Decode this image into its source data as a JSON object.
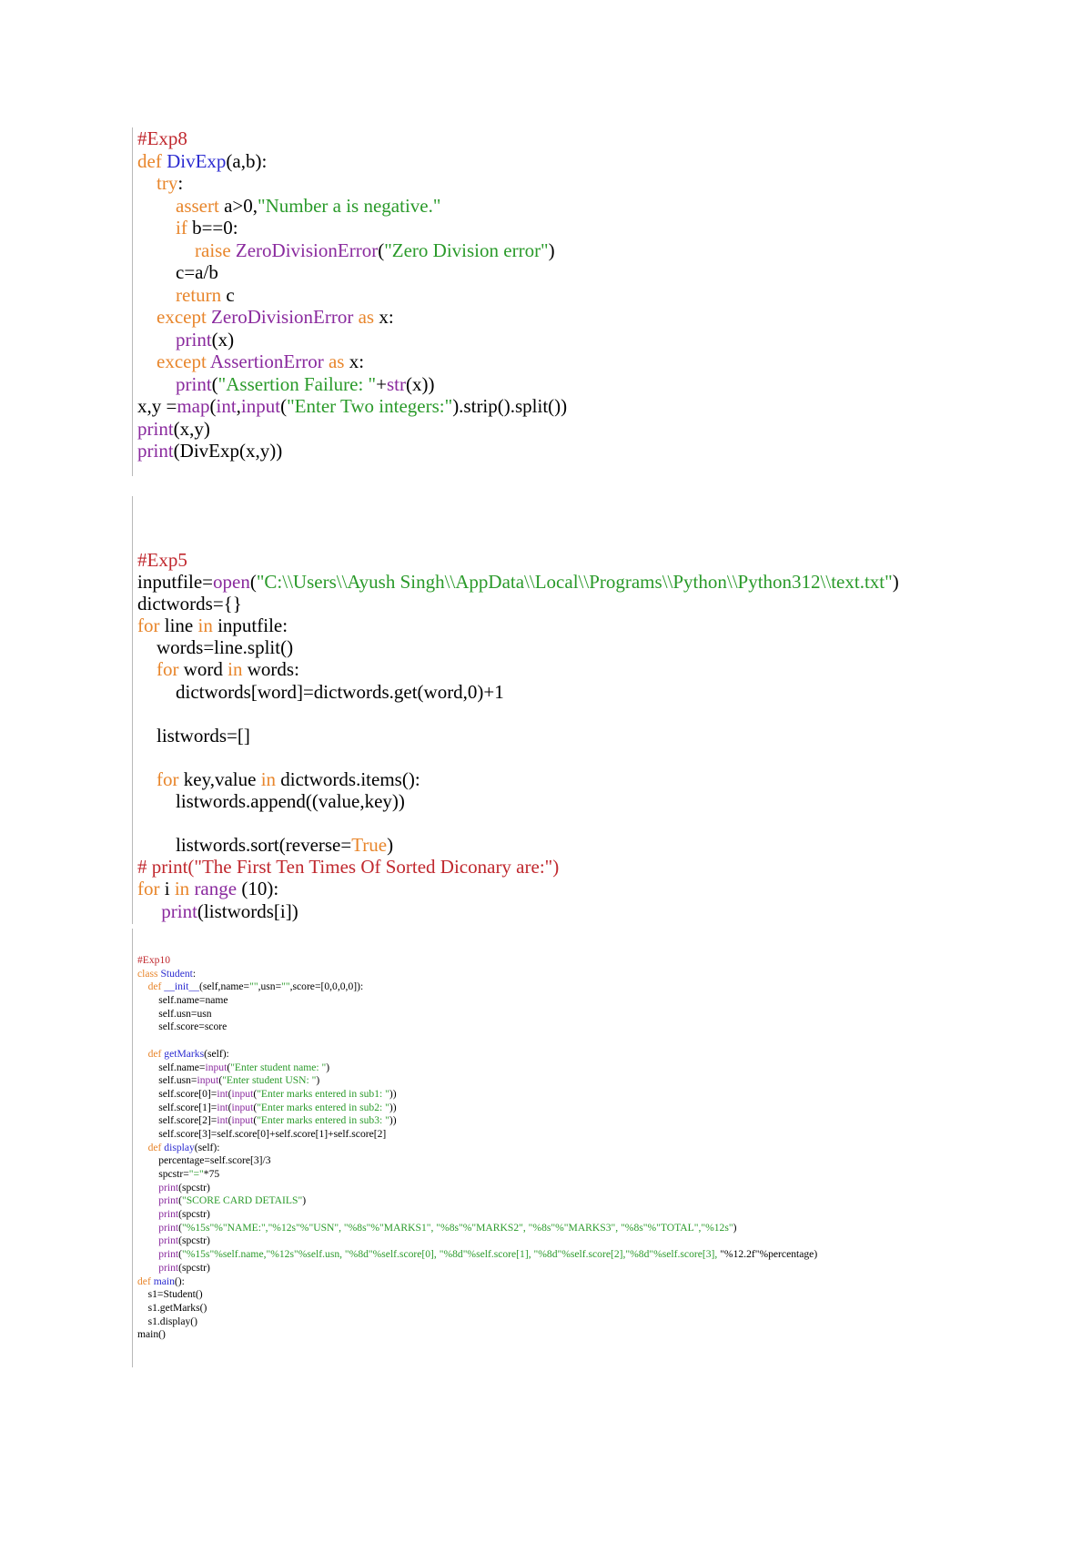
{
  "colors": {
    "comment": "#c0282e",
    "keyword": "#e8862c",
    "function_name": "#2b2bd0",
    "string": "#2a9a2a",
    "builtin": "#8a2a9e",
    "text": "#000000"
  },
  "exp8": [
    [
      [
        "cm",
        "#Exp8"
      ]
    ],
    [
      [
        "kw",
        "def "
      ],
      [
        "fn",
        "DivExp"
      ],
      [
        "tx",
        "(a,b):"
      ]
    ],
    [
      [
        "tx",
        "    "
      ],
      [
        "kw",
        "try"
      ],
      [
        "tx",
        ":"
      ]
    ],
    [
      [
        "tx",
        "        "
      ],
      [
        "kw",
        "assert "
      ],
      [
        "tx",
        "a>0,"
      ],
      [
        "st",
        "\"Number a is negative.\""
      ]
    ],
    [
      [
        "tx",
        "        "
      ],
      [
        "kw",
        "if "
      ],
      [
        "tx",
        "b==0:"
      ]
    ],
    [
      [
        "tx",
        "            "
      ],
      [
        "kw",
        "raise "
      ],
      [
        "bi",
        "ZeroDivisionError"
      ],
      [
        "tx",
        "("
      ],
      [
        "st",
        "\"Zero Division error\""
      ],
      [
        "tx",
        ")"
      ]
    ],
    [
      [
        "tx",
        "        c=a/b"
      ]
    ],
    [
      [
        "tx",
        "        "
      ],
      [
        "kw",
        "return "
      ],
      [
        "tx",
        "c"
      ]
    ],
    [
      [
        "tx",
        "    "
      ],
      [
        "kw",
        "except "
      ],
      [
        "bi",
        "ZeroDivisionError"
      ],
      [
        "kw",
        " as "
      ],
      [
        "tx",
        "x:"
      ]
    ],
    [
      [
        "tx",
        "        "
      ],
      [
        "bi",
        "print"
      ],
      [
        "tx",
        "(x)"
      ]
    ],
    [
      [
        "tx",
        "    "
      ],
      [
        "kw",
        "except "
      ],
      [
        "bi",
        "AssertionError"
      ],
      [
        "kw",
        " as "
      ],
      [
        "tx",
        "x:"
      ]
    ],
    [
      [
        "tx",
        "        "
      ],
      [
        "bi",
        "print"
      ],
      [
        "tx",
        "("
      ],
      [
        "st",
        "\"Assertion Failure: \""
      ],
      [
        "tx",
        "+"
      ],
      [
        "bi",
        "str"
      ],
      [
        "tx",
        "(x))"
      ]
    ],
    [
      [
        "tx",
        "x,y ="
      ],
      [
        "bi",
        "map"
      ],
      [
        "tx",
        "("
      ],
      [
        "bi",
        "int"
      ],
      [
        "tx",
        ","
      ],
      [
        "bi",
        "input"
      ],
      [
        "tx",
        "("
      ],
      [
        "st",
        "\"Enter Two integers:\""
      ],
      [
        "tx",
        ").strip().split())"
      ]
    ],
    [
      [
        "bi",
        "print"
      ],
      [
        "tx",
        "(x,y)"
      ]
    ],
    [
      [
        "bi",
        "print"
      ],
      [
        "tx",
        "(DivExp(x,y))"
      ]
    ]
  ],
  "exp5": [
    [
      [
        "cm",
        "#Exp5"
      ]
    ],
    [
      [
        "tx",
        "inputfile="
      ],
      [
        "bi",
        "open"
      ],
      [
        "tx",
        "("
      ],
      [
        "st",
        "\"C:\\\\Users\\\\Ayush Singh\\\\AppData\\\\Local\\\\Programs\\\\Python\\\\Python312\\\\text.txt\""
      ],
      [
        "tx",
        ")"
      ]
    ],
    [
      [
        "tx",
        "dictwords={}"
      ]
    ],
    [
      [
        "kw",
        "for "
      ],
      [
        "tx",
        "line "
      ],
      [
        "kw",
        "in "
      ],
      [
        "tx",
        "inputfile:"
      ]
    ],
    [
      [
        "tx",
        "    words=line.split()"
      ]
    ],
    [
      [
        "tx",
        "    "
      ],
      [
        "kw",
        "for "
      ],
      [
        "tx",
        "word "
      ],
      [
        "kw",
        "in "
      ],
      [
        "tx",
        "words:"
      ]
    ],
    [
      [
        "tx",
        "        dictwords[word]=dictwords.get(word,0)+1"
      ]
    ],
    [
      [
        "tx",
        ""
      ]
    ],
    [
      [
        "tx",
        "    listwords=[]"
      ]
    ],
    [
      [
        "tx",
        ""
      ]
    ],
    [
      [
        "tx",
        "    "
      ],
      [
        "kw",
        "for "
      ],
      [
        "tx",
        "key,value "
      ],
      [
        "kw",
        "in "
      ],
      [
        "tx",
        "dictwords.items():"
      ]
    ],
    [
      [
        "tx",
        "        listwords.append((value,key))"
      ]
    ],
    [
      [
        "tx",
        ""
      ]
    ],
    [
      [
        "tx",
        "        listwords.sort(reverse="
      ],
      [
        "kw",
        "True"
      ],
      [
        "tx",
        ")"
      ]
    ],
    [
      [
        "cm",
        "# print(\"The First Ten Times Of Sorted Diconary are:\")"
      ]
    ],
    [
      [
        "kw",
        "for "
      ],
      [
        "tx",
        "i "
      ],
      [
        "kw",
        "in "
      ],
      [
        "bi",
        "range"
      ],
      [
        "tx",
        " (10):"
      ]
    ],
    [
      [
        "tx",
        "     "
      ],
      [
        "bi",
        "print"
      ],
      [
        "tx",
        "(listwords[i])"
      ]
    ]
  ],
  "exp10": [
    [
      [
        "cm",
        "#Exp10"
      ]
    ],
    [
      [
        "kw",
        "class "
      ],
      [
        "fn",
        "Student"
      ],
      [
        "tx",
        ":"
      ]
    ],
    [
      [
        "tx",
        "    "
      ],
      [
        "kw",
        "def "
      ],
      [
        "fn",
        "__init__"
      ],
      [
        "tx",
        "(self,name="
      ],
      [
        "st",
        "\"\""
      ],
      [
        "tx",
        ",usn="
      ],
      [
        "st",
        "\"\""
      ],
      [
        "tx",
        ",score=[0,0,0,0]):"
      ]
    ],
    [
      [
        "tx",
        "        self.name=name"
      ]
    ],
    [
      [
        "tx",
        "        self.usn=usn"
      ]
    ],
    [
      [
        "tx",
        "        self.score=score"
      ]
    ],
    [
      [
        "tx",
        ""
      ]
    ],
    [
      [
        "tx",
        "    "
      ],
      [
        "kw",
        "def "
      ],
      [
        "fn",
        "getMarks"
      ],
      [
        "tx",
        "(self):"
      ]
    ],
    [
      [
        "tx",
        "        self.name="
      ],
      [
        "bi",
        "input"
      ],
      [
        "tx",
        "("
      ],
      [
        "st",
        "\"Enter student name: \""
      ],
      [
        "tx",
        ")"
      ]
    ],
    [
      [
        "tx",
        "        self.usn="
      ],
      [
        "bi",
        "input"
      ],
      [
        "tx",
        "("
      ],
      [
        "st",
        "\"Enter student USN: \""
      ],
      [
        "tx",
        ")"
      ]
    ],
    [
      [
        "tx",
        "        self.score[0]="
      ],
      [
        "bi",
        "int"
      ],
      [
        "tx",
        "("
      ],
      [
        "bi",
        "input"
      ],
      [
        "tx",
        "("
      ],
      [
        "st",
        "\"Enter marks entered in sub1: \""
      ],
      [
        "tx",
        "))"
      ]
    ],
    [
      [
        "tx",
        "        self.score[1]="
      ],
      [
        "bi",
        "int"
      ],
      [
        "tx",
        "("
      ],
      [
        "bi",
        "input"
      ],
      [
        "tx",
        "("
      ],
      [
        "st",
        "\"Enter marks entered in sub2: \""
      ],
      [
        "tx",
        "))"
      ]
    ],
    [
      [
        "tx",
        "        self.score[2]="
      ],
      [
        "bi",
        "int"
      ],
      [
        "tx",
        "("
      ],
      [
        "bi",
        "input"
      ],
      [
        "tx",
        "("
      ],
      [
        "st",
        "\"Enter marks entered in sub3: \""
      ],
      [
        "tx",
        "))"
      ]
    ],
    [
      [
        "tx",
        "        self.score[3]=self.score[0]+self.score[1]+self.score[2]"
      ]
    ],
    [
      [
        "tx",
        "    "
      ],
      [
        "kw",
        "def "
      ],
      [
        "fn",
        "display"
      ],
      [
        "tx",
        "(self):"
      ]
    ],
    [
      [
        "tx",
        "        percentage=self.score[3]/3"
      ]
    ],
    [
      [
        "tx",
        "        spcstr="
      ],
      [
        "st",
        "\"=\""
      ],
      [
        "tx",
        "*75"
      ]
    ],
    [
      [
        "tx",
        "        "
      ],
      [
        "bi",
        "print"
      ],
      [
        "tx",
        "(spcstr)"
      ]
    ],
    [
      [
        "tx",
        "        "
      ],
      [
        "bi",
        "print"
      ],
      [
        "tx",
        "("
      ],
      [
        "st",
        "\"SCORE CARD DETAILS\""
      ],
      [
        "tx",
        ")"
      ]
    ],
    [
      [
        "tx",
        "        "
      ],
      [
        "bi",
        "print"
      ],
      [
        "tx",
        "(spcstr)"
      ]
    ],
    [
      [
        "tx",
        "        "
      ],
      [
        "bi",
        "print"
      ],
      [
        "tx",
        "("
      ],
      [
        "st",
        "\"%15s\"%\"NAME:\",\"%12s\"%\"USN\", \"%8s\"%\"MARKS1\", \"%8s\"%\"MARKS2\", \"%8s\"%\"MARKS3\", \"%8s\"%\"TOTAL\",\"%12s\""
      ],
      [
        "tx",
        ")"
      ]
    ],
    [
      [
        "tx",
        "        "
      ],
      [
        "bi",
        "print"
      ],
      [
        "tx",
        "(spcstr)"
      ]
    ],
    [
      [
        "tx",
        "        "
      ],
      [
        "bi",
        "print"
      ],
      [
        "tx",
        "("
      ],
      [
        "st",
        "\"%15s\"%self.name,\"%12s\"%self.usn, \"%8d\"%self.score[0], \"%8d\"%self.score[1], \"%8d\"%self.score[2],\"%8d\"%self.score[3], "
      ],
      [
        "bk",
        "\"%12.2f\"%percentage)"
      ]
    ],
    [
      [
        "tx",
        "        "
      ],
      [
        "bi",
        "print"
      ],
      [
        "tx",
        "(spcstr)"
      ]
    ],
    [
      [
        "kw",
        "def "
      ],
      [
        "fn",
        "main"
      ],
      [
        "tx",
        "():"
      ]
    ],
    [
      [
        "tx",
        "    s1=Student()"
      ]
    ],
    [
      [
        "tx",
        "    s1.getMarks()"
      ]
    ],
    [
      [
        "tx",
        "    s1.display()"
      ]
    ],
    [
      [
        "tx",
        "main()"
      ]
    ]
  ]
}
